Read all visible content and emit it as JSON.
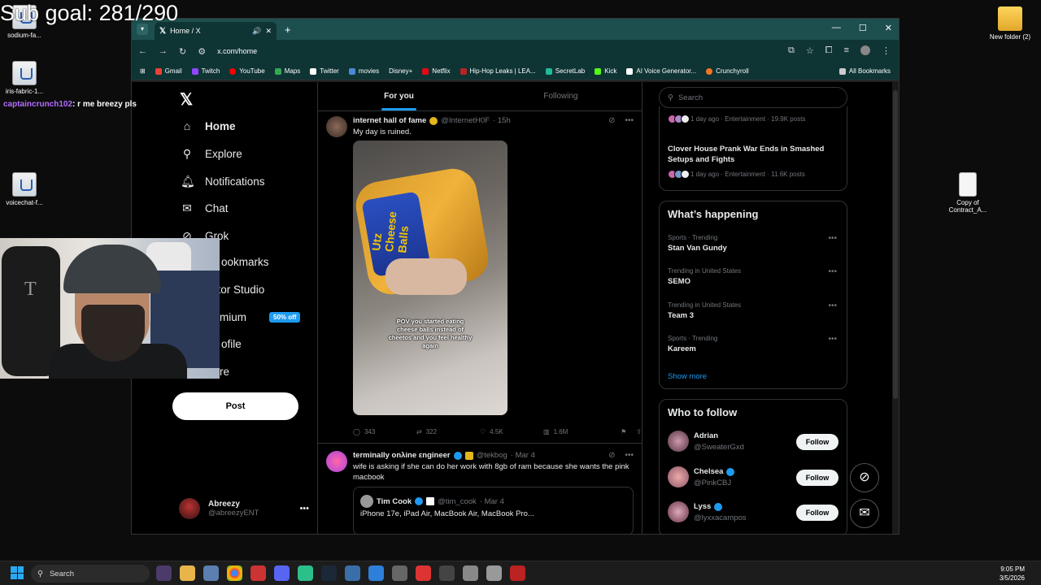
{
  "overlay": {
    "goal": "Sub goal: 281/290"
  },
  "chat": {
    "user": "captaincrunch102",
    "message": ": r me breezy pls"
  },
  "desktop": {
    "icons": [
      {
        "label": "sodium-fa..."
      },
      {
        "label": "iris-fabric-1..."
      },
      {
        "label": "voicechat-f..."
      },
      {
        "label": "New folder (2)"
      },
      {
        "label": "Copy of Contract_A..."
      }
    ]
  },
  "browser": {
    "tab_title": "Home / X",
    "url": "x.com/home",
    "bookmarks": [
      "Gmail",
      "Twitch",
      "YouTube",
      "Maps",
      "Twitter",
      "movies",
      "Disney+",
      "Netflix",
      "Hip-Hop Leaks | LEA...",
      "SecretLab",
      "Kick",
      "AI Voice Generator...",
      "Crunchyroll"
    ],
    "all_bookmarks": "All Bookmarks"
  },
  "nav": {
    "items": [
      {
        "label": "Home",
        "icon": "home-icon"
      },
      {
        "label": "Explore",
        "icon": "search-icon"
      },
      {
        "label": "Notifications",
        "icon": "bell-icon"
      },
      {
        "label": "Chat",
        "icon": "mail-icon"
      },
      {
        "label": "Grok",
        "icon": "grok-icon"
      },
      {
        "label": "ookmarks",
        "icon": "bookmark-icon"
      },
      {
        "label": "ator Studio",
        "icon": "studio-icon"
      },
      {
        "label": "mium",
        "icon": "premium-icon"
      },
      {
        "label": "ofile",
        "icon": "profile-icon"
      },
      {
        "label": "re",
        "icon": "more-icon"
      }
    ],
    "premium_badge": "50% off",
    "post_label": "Post",
    "account_name": "Abreezy",
    "account_handle": "@abreezyENT"
  },
  "timeline": {
    "tabs": [
      "For you",
      "Following"
    ],
    "tweet1": {
      "name": "internet hall of fame",
      "handle": "@InternetH0F",
      "time": "· 15h",
      "text": "My day is ruined.",
      "media_brand": "Utz Cheese Balls",
      "caption": "POV you started eating cheese balls instead of cheetos and you feel healthy again",
      "replies": "343",
      "reposts": "322",
      "likes": "4.5K",
      "views": "1.6M"
    },
    "tweet2": {
      "name": "terminally onλine εngineer",
      "handle": "@tekbog",
      "time": "· Mar 4",
      "text": "wife is asking if she can do her work with 8gb of ram because she wants the pink macbook",
      "quote_name": "Tim Cook",
      "quote_handle": "@tim_cook",
      "quote_time": "· Mar 4",
      "quote_text": "iPhone 17e, iPad Air, MacBook Air, MacBook Pro..."
    }
  },
  "right": {
    "search_placeholder": "Search",
    "trend_top_meta": "1 day ago · Entertainment · 19.9K posts",
    "trend_story_title": "Clover House Prank War Ends in Smashed Setups and Fights",
    "trend_story_meta": "1 day ago · Entertainment · 11.6K posts",
    "happening_title": "What’s happening",
    "trends": [
      {
        "cat": "Sports · Trending",
        "name": "Stan Van Gundy"
      },
      {
        "cat": "Trending in United States",
        "name": "SEMO"
      },
      {
        "cat": "Trending in United States",
        "name": "Team 3"
      },
      {
        "cat": "Sports · Trending",
        "name": "Kareem"
      }
    ],
    "show_more": "Show more",
    "wtf_title": "Who to follow",
    "follow_label": "Follow",
    "who_to_follow": [
      {
        "name": "Adrian",
        "handle": "@SweaterGxd"
      },
      {
        "name": "Chelsea",
        "handle": "@PinkCBJ"
      },
      {
        "name": "Lyss",
        "handle": "@lyxxacampos"
      }
    ]
  },
  "taskbar": {
    "search": "Search",
    "time": "9:05 PM",
    "date": "3/5/2026"
  },
  "colors": {
    "accent": "#1d9bf0",
    "tab_bar": "#1e4f4f",
    "verified": "#1d9bf0",
    "gold": "#e2b719"
  }
}
